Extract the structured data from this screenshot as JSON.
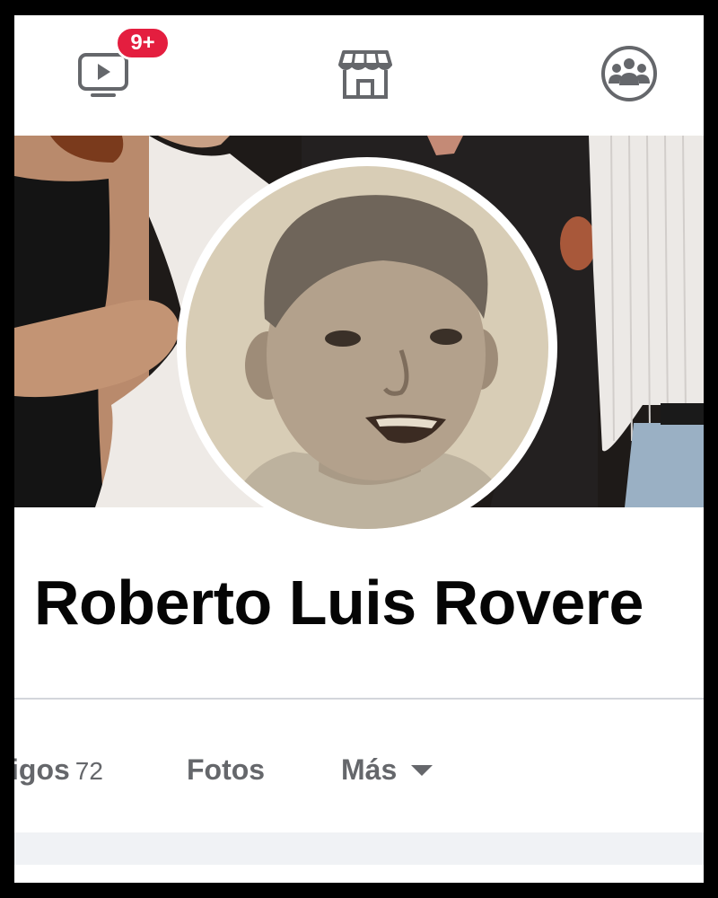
{
  "topnav": {
    "items": [
      {
        "icon": "video-icon",
        "badge": "9+"
      },
      {
        "icon": "marketplace-icon"
      },
      {
        "icon": "groups-icon"
      }
    ]
  },
  "profile": {
    "name": "Roberto Luis Rovere"
  },
  "tabs": [
    {
      "label": "igos",
      "count": "72"
    },
    {
      "label": "Fotos"
    },
    {
      "label": "Más"
    }
  ],
  "colors": {
    "badge": "#e41e3f",
    "icon_gray": "#65676b",
    "name": "#050505"
  }
}
